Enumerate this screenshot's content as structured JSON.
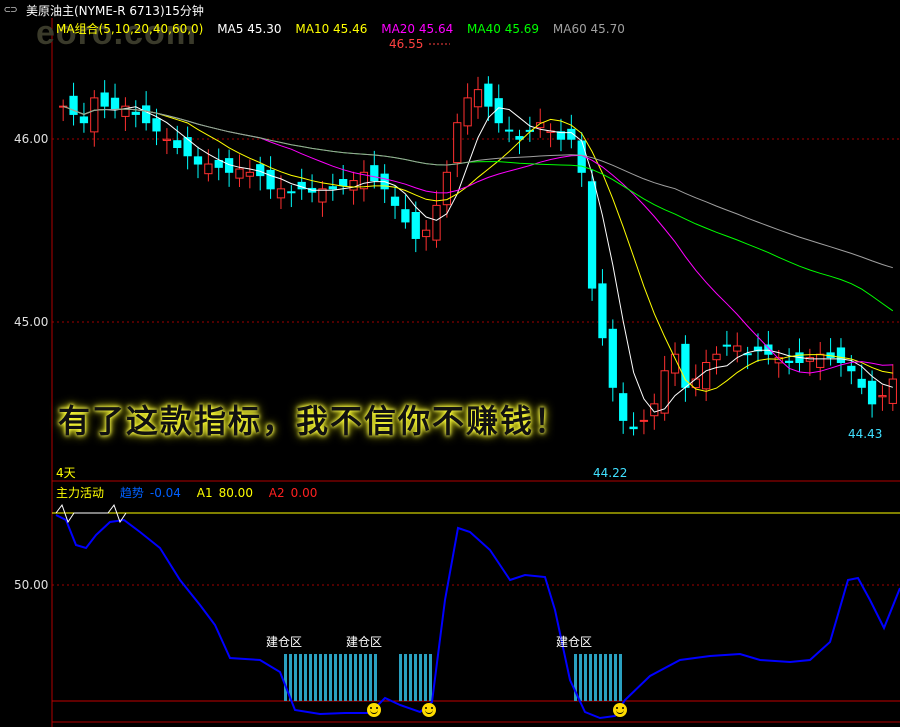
{
  "window": {
    "icon": "chain-link-icon",
    "title": "美原油主(NYME-R 6713)15分钟",
    "watermark": "eoro.com"
  },
  "ma_legend": {
    "group": "MA组合(5,10,20,40,60,0)",
    "ma5": "MA5 45.30",
    "ma10": "MA10 45.46",
    "ma20": "MA20 45.64",
    "ma40": "MA40 45.69",
    "ma60": "MA60 45.70"
  },
  "colors": {
    "ma5": "#ffffff",
    "ma10": "#ffff00",
    "ma20": "#ff00ff",
    "ma40": "#00ff00",
    "ma60": "#a0a0a0",
    "up": "#ff3030",
    "down": "#00ffff",
    "trend": "#0000ff",
    "a1": "#ffff00",
    "a2": "#ff0000",
    "zone_bar": "#2aa0c0"
  },
  "price_axis": {
    "top_label": "46.00",
    "mid_label": "45.00"
  },
  "annotations": {
    "high": "46.55",
    "low": "44.22",
    "local_low": "44.43",
    "period": "4天"
  },
  "banner": "有了这款指标，我不信你不赚钱！",
  "indicator": {
    "name": "主力活动",
    "trend_label": "趋势",
    "trend_value": "-0.04",
    "a1_label": "A1",
    "a1_value": "80.00",
    "a2_label": "A2",
    "a2_value": "0.00",
    "axis_label": "50.00",
    "zone_label": "建仓区"
  },
  "chart_data": {
    "type": "candlestick",
    "price_range": [
      44.1,
      46.7
    ],
    "close": [
      46.3,
      46.25,
      46.2,
      46.35,
      46.3,
      46.28,
      46.3,
      46.25,
      46.2,
      46.15,
      46.1,
      46.05,
      46.0,
      45.95,
      45.95,
      45.93,
      45.9,
      45.92,
      45.9,
      45.88,
      45.8,
      45.8,
      45.78,
      45.8,
      45.78,
      45.8,
      45.8,
      45.82,
      45.85,
      45.9,
      45.85,
      45.8,
      45.7,
      45.6,
      45.5,
      45.55,
      45.7,
      45.9,
      46.2,
      46.35,
      46.4,
      46.3,
      46.2,
      46.15,
      46.1,
      46.15,
      46.2,
      46.15,
      46.1,
      46.1,
      45.9,
      45.2,
      44.9,
      44.6,
      44.4,
      44.35,
      44.4,
      44.5,
      44.7,
      44.8,
      44.6,
      44.65,
      44.75,
      44.8,
      44.85,
      44.85,
      44.8,
      44.82,
      44.8,
      44.78,
      44.75,
      44.75,
      44.78,
      44.8,
      44.78,
      44.75,
      44.7,
      44.6,
      44.5,
      44.55,
      44.65
    ],
    "trend_indicator": {
      "axis_label": 50,
      "a1": 80,
      "a2": 0,
      "trend_last": -0.04
    }
  }
}
